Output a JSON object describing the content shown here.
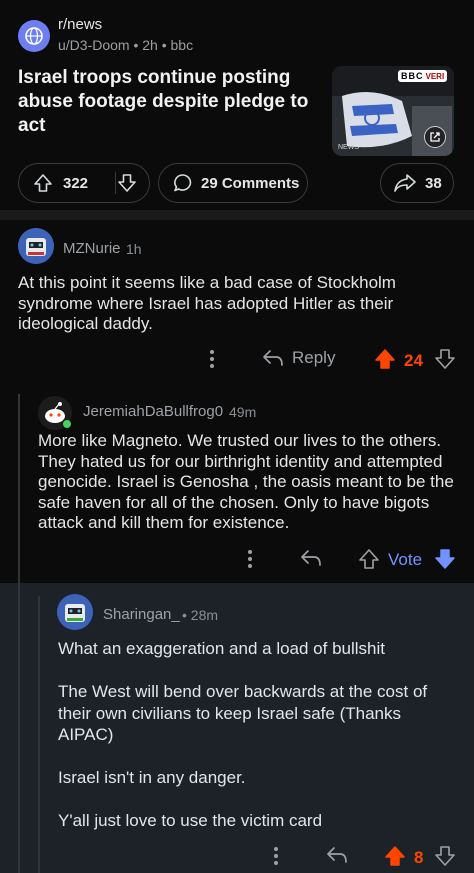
{
  "post": {
    "subreddit": "r/news",
    "meta": "u/D3-Doom • 2h • bbc",
    "title": "Israel troops continue posting abuse footage despite pledge to act",
    "thumbnail_badge": "BBC",
    "thumbnail_badge_suffix": "VERI",
    "thumbnail_caption": "NEWS",
    "score": "322",
    "comments": "29 Comments",
    "shares": "38"
  },
  "comments": [
    {
      "user": "MZNurie",
      "time": "1h",
      "text": "At this point it seems like a bad case of Stockholm syndrome where Israel has adopted Hitler as their ideological daddy.",
      "reply_label": "Reply",
      "score": "24",
      "vote_state": "upvoted"
    },
    {
      "user": "JeremiahDaBullfrog0",
      "time": "49m",
      "text": "More like Magneto. We trusted our lives to the others. They hated us for our birthright identity and attempted genocide. Israel is Genosha , the oasis meant to be the safe haven for all of the chosen. Only to have bigots attack and kill them for existence.",
      "vote_label": "Vote",
      "vote_state": "downvoted"
    },
    {
      "user": "Sharingan_",
      "time": "• 28m",
      "text": "What an exaggeration and a load of bullshit\n\nThe West will bend over backwards at the cost of their own civilians to keep Israel safe (Thanks AIPAC)\n\nIsrael isn't in any danger.\n\nY'all just love to use the victim card",
      "score": "8",
      "vote_state": "upvoted"
    }
  ],
  "colors": {
    "upvote": "#ff4500",
    "downvote": "#7193ff",
    "background": "#0b0b0b",
    "highlight": "#1d2229"
  }
}
